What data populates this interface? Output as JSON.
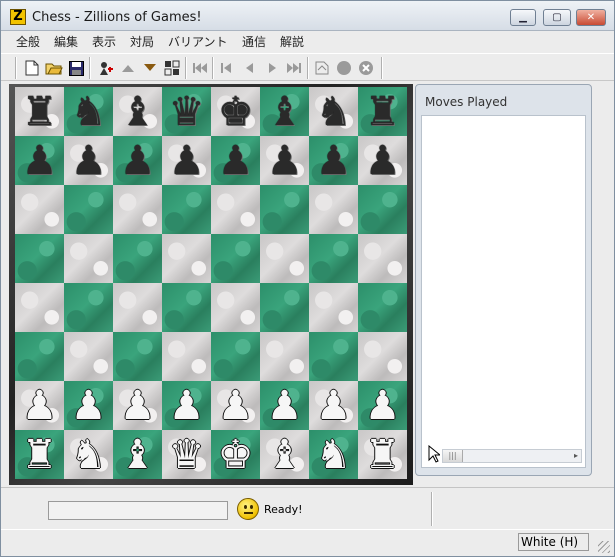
{
  "window": {
    "title": "Chess - Zillions of Games!",
    "app_icon_letter": "Z"
  },
  "menu": [
    "全般",
    "編集",
    "表示",
    "対局",
    "バリアント",
    "通信",
    "解説"
  ],
  "toolbar": {
    "icons": [
      "new-icon",
      "open-icon",
      "save-icon",
      "engine-icon",
      "arrow-up-icon",
      "arrow-down-icon",
      "swap-board-icon",
      "rewind-start-icon",
      "step-back-icon",
      "back-icon",
      "forward-icon",
      "forward-end-icon",
      "hint-icon",
      "circle-icon",
      "stop-icon"
    ]
  },
  "board": {
    "rows": [
      [
        "♜",
        "♞",
        "♝",
        "♛",
        "♚",
        "♝",
        "♞",
        "♜"
      ],
      [
        "♟",
        "♟",
        "♟",
        "♟",
        "♟",
        "♟",
        "♟",
        "♟"
      ],
      [
        "",
        "",
        "",
        "",
        "",
        "",
        "",
        ""
      ],
      [
        "",
        "",
        "",
        "",
        "",
        "",
        "",
        ""
      ],
      [
        "",
        "",
        "",
        "",
        "",
        "",
        "",
        ""
      ],
      [
        "",
        "",
        "",
        "",
        "",
        "",
        "",
        ""
      ],
      [
        "♟",
        "♟",
        "♟",
        "♟",
        "♟",
        "♟",
        "♟",
        "♟"
      ],
      [
        "♜",
        "♞",
        "♝",
        "♛",
        "♚",
        "♝",
        "♞",
        "♜"
      ]
    ],
    "colors": [
      "black",
      "black",
      "",
      "",
      "",
      "",
      "white",
      "white"
    ],
    "light_color": "#d6d4d4",
    "dark_color": "#33956f"
  },
  "moves_panel": {
    "title": "Moves Played",
    "moves": []
  },
  "status": {
    "message": "Ready!",
    "player": "White (H)"
  }
}
